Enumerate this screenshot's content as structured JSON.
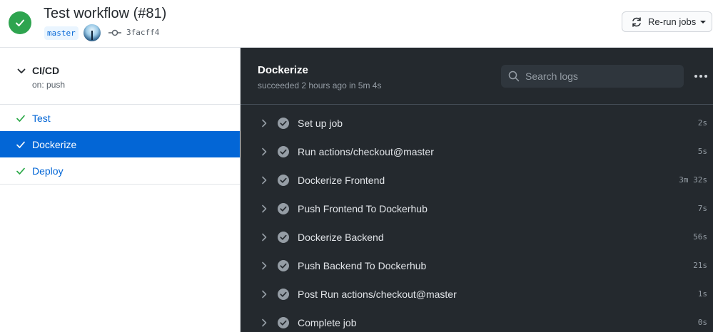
{
  "header": {
    "title": "Test workflow (#81)",
    "branch": "master",
    "commit_sha": "3facff4",
    "rerun_label": "Re-run jobs",
    "status_color": "#2ea44f"
  },
  "sidebar": {
    "workflow_name": "CI/CD",
    "workflow_trigger": "on: push",
    "jobs": [
      {
        "label": "Test",
        "status": "success"
      },
      {
        "label": "Dockerize",
        "status": "success",
        "active": true
      },
      {
        "label": "Deploy",
        "status": "success"
      }
    ]
  },
  "job": {
    "title": "Dockerize",
    "meta": "succeeded 2 hours ago in 5m 4s",
    "search_placeholder": "Search logs",
    "steps": [
      {
        "name": "Set up job",
        "duration": "2s"
      },
      {
        "name": "Run actions/checkout@master",
        "duration": "5s"
      },
      {
        "name": "Dockerize Frontend",
        "duration": "3m 32s"
      },
      {
        "name": "Push Frontend To Dockerhub",
        "duration": "7s"
      },
      {
        "name": "Dockerize Backend",
        "duration": "56s"
      },
      {
        "name": "Push Backend To Dockerhub",
        "duration": "21s"
      },
      {
        "name": "Post Run actions/checkout@master",
        "duration": "1s"
      },
      {
        "name": "Complete job",
        "duration": "0s"
      }
    ]
  },
  "colors": {
    "accent": "#0366d6",
    "success": "#2ea44f",
    "dark_bg": "#24292e"
  },
  "icons": {
    "status": "check-circle-icon",
    "commit": "git-commit-icon",
    "rerun": "sync-icon",
    "search": "search-icon",
    "menu": "kebab-horizontal-icon",
    "expand": "chevron-right-icon"
  }
}
